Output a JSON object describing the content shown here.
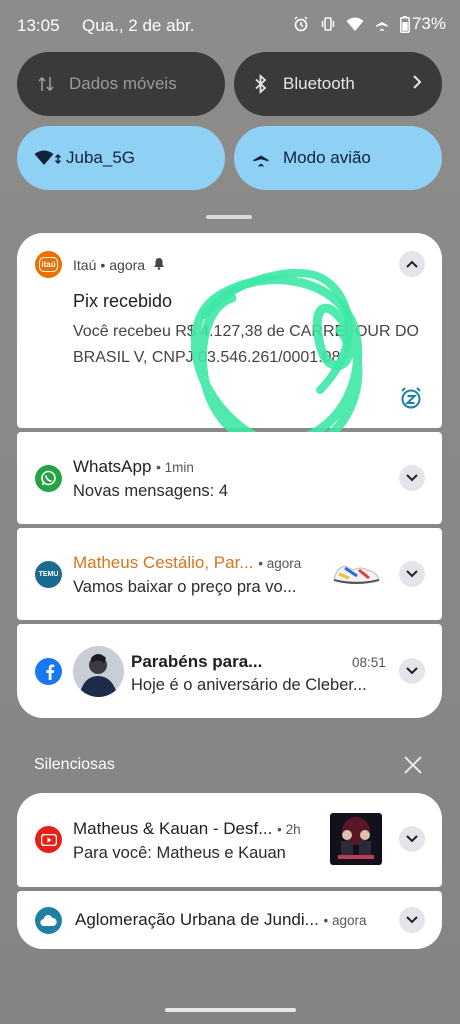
{
  "status_bar": {
    "time": "13:05",
    "date": "Qua., 2 de abr.",
    "battery": "73%",
    "icons": [
      "alarm-icon",
      "vibrate-icon",
      "wifi-icon",
      "airplane-icon",
      "battery-icon"
    ]
  },
  "quick_settings": {
    "tiles": [
      {
        "label": "Dados móveis",
        "icon": "mobile-data-icon",
        "state": "off"
      },
      {
        "label": "Bluetooth",
        "icon": "bluetooth-icon",
        "state": "off"
      },
      {
        "label": "Juba_5G",
        "icon": "wifi-icon",
        "state": "on"
      },
      {
        "label": "Modo avião",
        "icon": "airplane-icon",
        "state": "on"
      }
    ]
  },
  "notifications": [
    {
      "app": "Itaú",
      "app_icon_text": "itaú",
      "time": "agora",
      "title": "Pix recebido",
      "body_line1": "Você recebeu R$ 4.127,38 de CARREFOUR DO",
      "body_line2": "BRASIL V, CNPJ 03.546.261/0001.08."
    },
    {
      "app": "WhatsApp",
      "time": "1min",
      "text": "Novas mensagens: 4"
    },
    {
      "sender": "Matheus Cestálio, Par...",
      "time": "agora",
      "text": "Vamos baixar o preço pra vo...",
      "app_icon_text": "TEMU"
    },
    {
      "title": "Parabéns para...",
      "time": "08:51",
      "text": "Hoje é o aniversário de Cleber..."
    }
  ],
  "silent_section": {
    "label": "Silenciosas",
    "items": [
      {
        "title": "Matheus & Kauan - Desf...",
        "time": "2h",
        "text": "Para você: Matheus e Kauan"
      },
      {
        "title": "Aglomeração Urbana de Jundi...",
        "time": "agora"
      }
    ]
  },
  "colors": {
    "tile_active": "#8fd0f5",
    "tile_inactive": "#3a3a3a",
    "itau_orange": "#ec7000",
    "whatsapp_green": "#25a244",
    "temu_blue": "#1a6b8f",
    "facebook_blue": "#1877f2",
    "youtube_red": "#e62117",
    "scribble_green": "#3de8a6"
  }
}
